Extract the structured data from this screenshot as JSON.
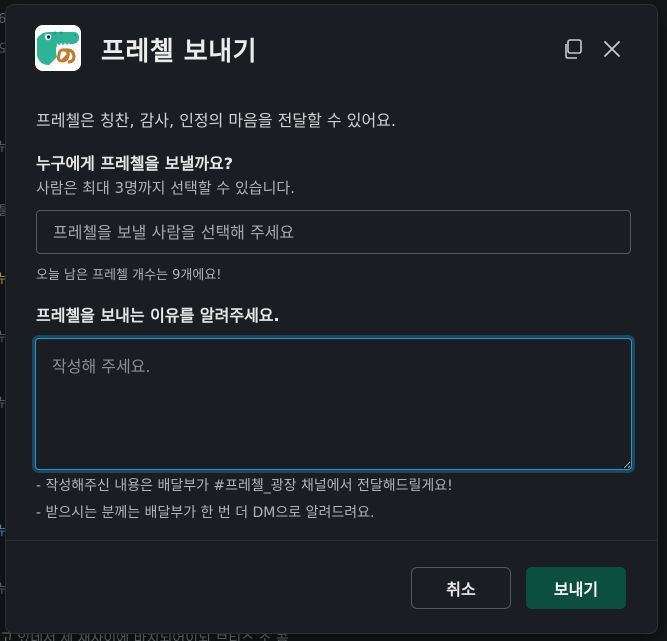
{
  "background": {
    "bottom_text": "고 있네서 제 채사이에 바치되어이되 브티스 소 콤"
  },
  "modal": {
    "title": "프레첼 보내기",
    "intro": "프레첼은 칭찬, 감사, 인정의 마음을 전달할 수 있어요.",
    "recipient_question": "누구에게 프레첼을 보낼까요?",
    "recipient_hint": "사람은 최대 3명까지 선택할 수 있습니다.",
    "recipient_placeholder": "프레첼을 보낼 사람을 선택해 주세요",
    "remaining_text": "오늘 남은 프레첼 개수는 9개에요!",
    "reason_question": "프레첼을 보내는 이유를 알려주세요.",
    "reason_placeholder": "작성해 주세요.",
    "hint_line1": "- 작성해주신 내용은 배달부가 #프레첼_광장 채널에서 전달해드릴게요!",
    "hint_line2": "- 받으시는 분께는 배달부가 한 번 더 DM으로 알려드려요.",
    "cancel_label": "취소",
    "send_label": "보내기"
  },
  "icons": {
    "logo": "crocodile-pretzel-icon",
    "copy": "copy-icon",
    "close": "close-icon"
  },
  "colors": {
    "modal_bg": "#1a1d21",
    "focus_ring": "#1d9bd1",
    "send_button": "#0b4f3f",
    "logo_green": "#2bb596"
  }
}
